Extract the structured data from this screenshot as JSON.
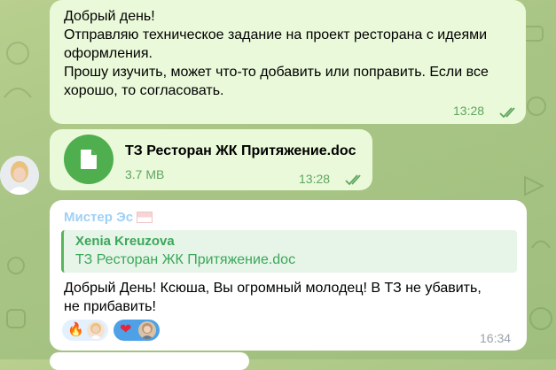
{
  "messages": {
    "m1": {
      "lines": [
        "Добрый день!",
        "Отправляю техническое задание на проект ресторана с идеями",
        "оформления.",
        "Прошу изучить, может что-то добавить или поправить. Если все",
        "хорошо, то согласовать."
      ],
      "time": "13:28"
    },
    "m2": {
      "file_name": "ТЗ Ресторан ЖК  Притяжение.doc",
      "file_size": "3.7 MB",
      "time": "13:28"
    },
    "m3": {
      "sender": "Мистер Эс",
      "reply_author": "Xenia Kreuzova",
      "reply_text": "ТЗ Ресторан ЖК  Притяжение.doc",
      "lines": [
        "Добрый День! Ксюша, Вы огромный молодец! В ТЗ не убавить,",
        "не прибавить!"
      ],
      "reactions": [
        {
          "emoji": "🔥",
          "active": false
        },
        {
          "emoji": "❤",
          "active": true
        }
      ],
      "time": "16:34"
    }
  },
  "colors": {
    "outgoing_bubble": "#eaf9d9",
    "incoming_bubble": "#ffffff",
    "accent_green": "#4fae4e",
    "time_green": "#5fa561"
  }
}
